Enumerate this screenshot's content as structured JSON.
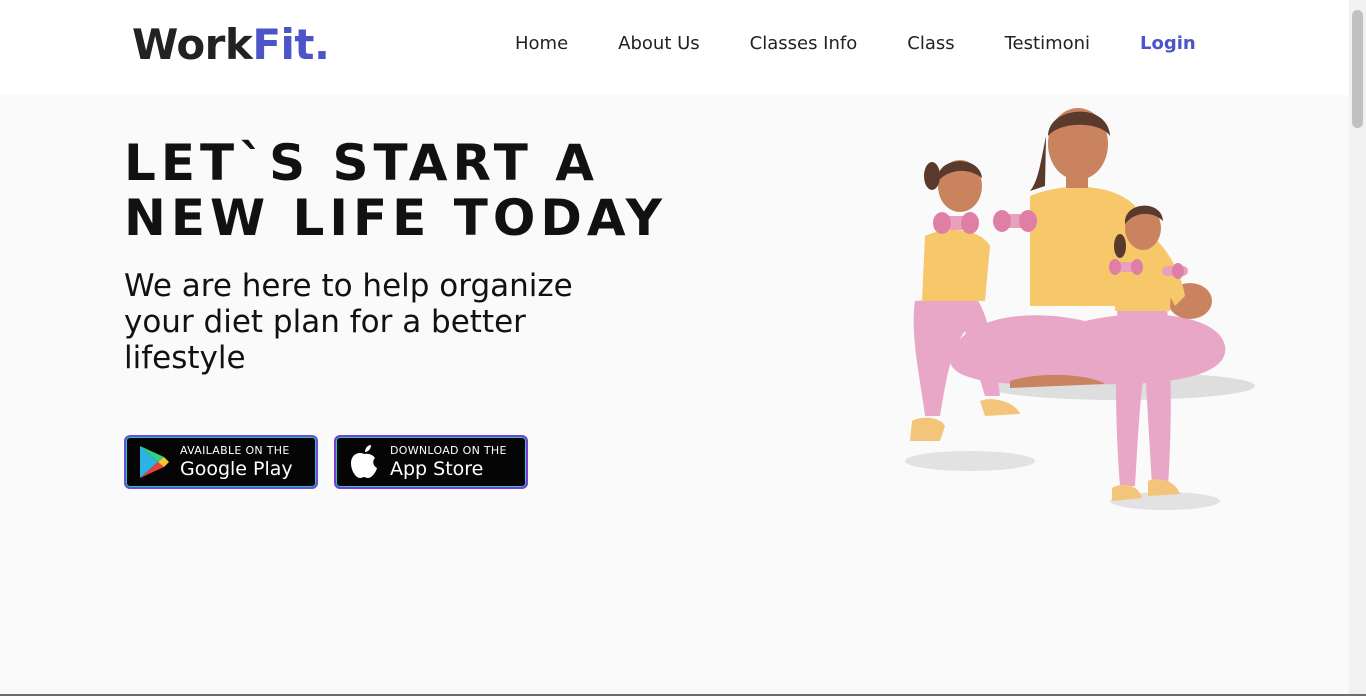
{
  "header": {
    "logo_main": "Work",
    "logo_accent": "Fit."
  },
  "nav": {
    "items": [
      "Home",
      "About Us",
      "Classes Info",
      "Class",
      "Testimoni"
    ],
    "login": "Login"
  },
  "hero": {
    "headline_line1": "LET`S START A",
    "headline_line2": "NEW LIFE TODAY",
    "tagline": "We are here to help organize your diet plan for a better lifestyle"
  },
  "stores": {
    "google": {
      "small": "AVAILABLE ON THE",
      "big": "Google Play",
      "icon": "google-play-icon"
    },
    "apple": {
      "small": "DOWNLOAD ON THE",
      "big": "App Store",
      "icon": "apple-icon"
    }
  },
  "colors": {
    "accent": "#4b55c8",
    "background": "#fafafa",
    "header_bg": "#ffffff",
    "shirt": "#f6c86a",
    "pants": "#e9a7c8"
  }
}
